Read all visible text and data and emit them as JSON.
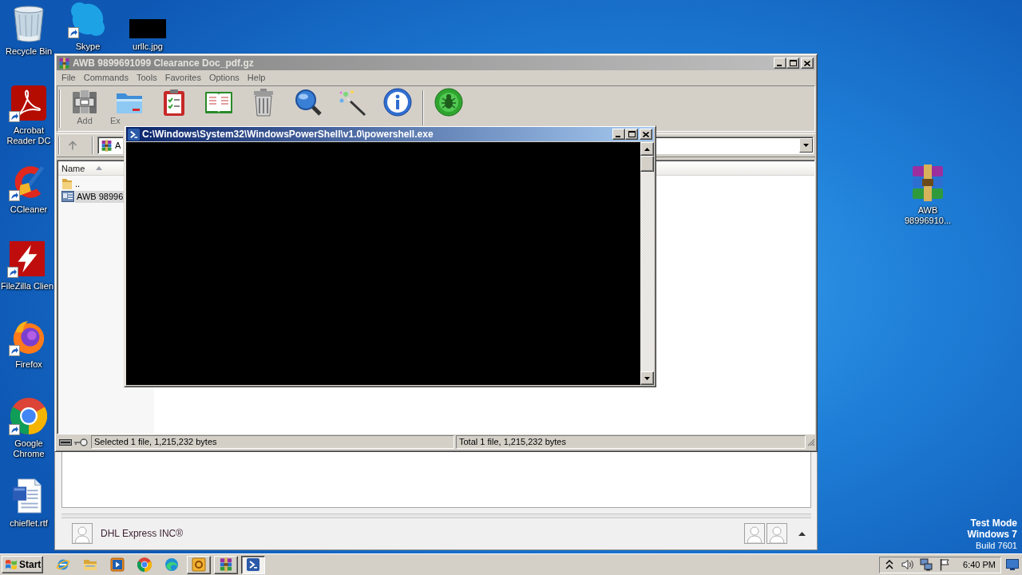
{
  "desktop_icons": [
    {
      "label": "Recycle Bin",
      "kind": "recycle",
      "shortcut": false
    },
    {
      "label": "Skype",
      "kind": "skype",
      "shortcut": true
    },
    {
      "label": "urllc.jpg",
      "kind": "image",
      "shortcut": false
    },
    {
      "label": "Acrobat Reader DC",
      "kind": "acrobat",
      "shortcut": true
    },
    {
      "label": "CCleaner",
      "kind": "ccleaner",
      "shortcut": true
    },
    {
      "label": "FileZilla Clien",
      "kind": "filezilla",
      "shortcut": true
    },
    {
      "label": "Firefox",
      "kind": "firefox",
      "shortcut": true
    },
    {
      "label": "Google Chrome",
      "kind": "chrome",
      "shortcut": true
    },
    {
      "label": "chieflet.rtf",
      "kind": "word",
      "shortcut": false
    },
    {
      "label": "AWB 98996910...",
      "kind": "archive",
      "shortcut": false
    }
  ],
  "archive_window": {
    "title": "AWB 9899691099 Clearance Doc_pdf.gz",
    "active": false,
    "menu": [
      "File",
      "Commands",
      "Tools",
      "Favorites",
      "Options",
      "Help"
    ],
    "toolbar": [
      [
        {
          "kind": "add",
          "label": "Add"
        },
        {
          "kind": "extract",
          "label": "Ex"
        },
        {
          "kind": "test"
        },
        {
          "kind": "view"
        },
        {
          "kind": "delete"
        },
        {
          "kind": "find"
        },
        {
          "kind": "wizard"
        },
        {
          "kind": "info"
        }
      ],
      [
        {
          "kind": "scan"
        }
      ]
    ],
    "address": {
      "value": "A"
    },
    "file_list": {
      "columns": [
        {
          "label": "Name",
          "sorted": true
        }
      ],
      "rows": [
        {
          "name": "..",
          "kind": "folder",
          "selected": false
        },
        {
          "name": "AWB 98996",
          "kind": "file",
          "selected": true
        }
      ]
    },
    "status_bar": {
      "selected": "Selected 1 file, 1,215,232 bytes",
      "total": "Total 1 file, 1,215,232 bytes"
    }
  },
  "console_window": {
    "title": "C:\\Windows\\System32\\WindowsPowerShell\\v1.0\\powershell.exe",
    "active": true
  },
  "mail_pane": {
    "sender": "DHL Express INC®"
  },
  "desktop_notice": [
    {
      "text": "Test Mode",
      "bold": true
    },
    {
      "text": "Windows 7",
      "bold": true
    },
    {
      "text": "Build 7601",
      "bold": false
    }
  ],
  "taskbar": {
    "start": "Start",
    "quick_launch": [
      {
        "kind": "ie"
      },
      {
        "kind": "explorer"
      },
      {
        "kind": "media"
      },
      {
        "kind": "chrome"
      },
      {
        "kind": "edge"
      }
    ],
    "tasks": [
      {
        "kind": "outlook",
        "selected": false
      },
      {
        "kind": "winrar",
        "selected": false
      },
      {
        "kind": "powershell",
        "selected": true
      }
    ],
    "tray": [
      {
        "kind": "chevron"
      },
      {
        "kind": "speaker"
      },
      {
        "kind": "network"
      },
      {
        "kind": "flag"
      }
    ],
    "clock": "6:40 PM"
  }
}
